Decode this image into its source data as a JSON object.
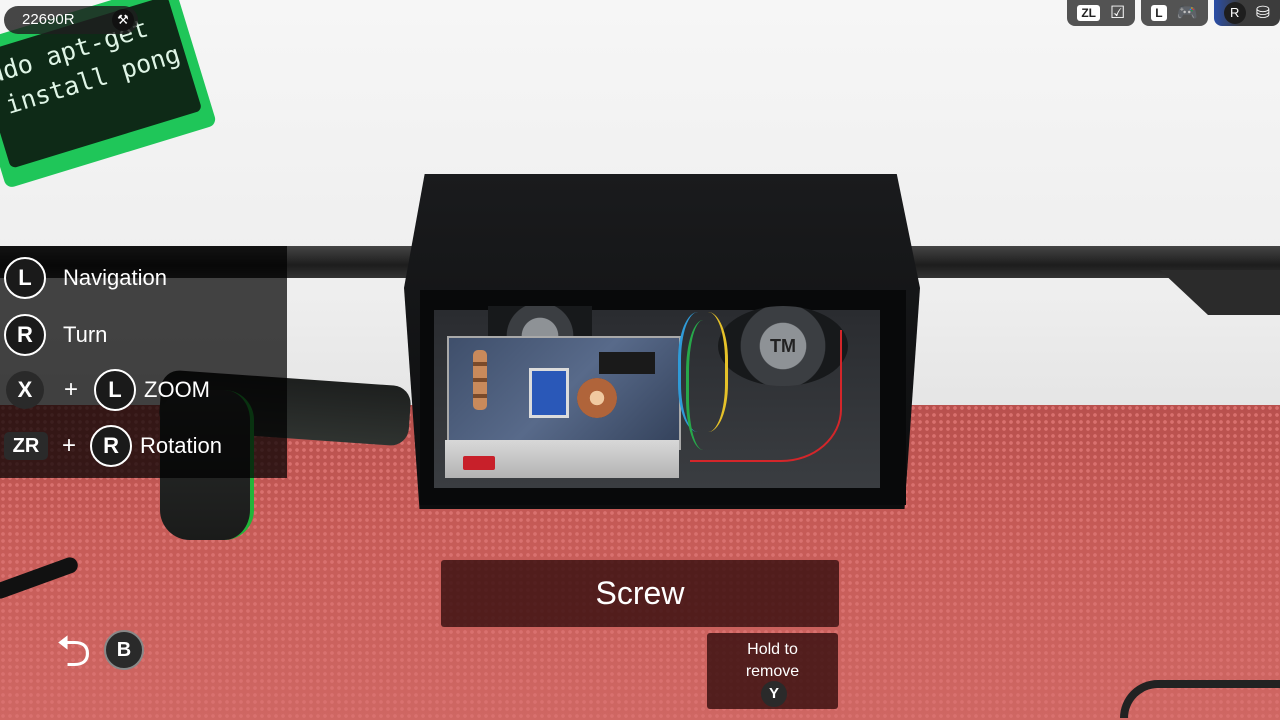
{
  "hud": {
    "currency": "22690R",
    "currency_icon": "wrench-icon"
  },
  "sticky_note": {
    "line1": "udo apt-get",
    "line2": "install pong"
  },
  "top_right": {
    "zl_label": "ZL",
    "l_label": "L",
    "r_label": "R"
  },
  "controls": {
    "navigation": {
      "button": "L",
      "label": "Navigation"
    },
    "turn": {
      "button": "R",
      "label": "Turn"
    },
    "zoom": {
      "button1": "X",
      "plus": "+",
      "button2": "L",
      "label": "ZOOM"
    },
    "rotation": {
      "button1": "ZR",
      "plus": "+",
      "button2": "R",
      "label": "Rotation"
    }
  },
  "back": {
    "button": "B"
  },
  "action": {
    "title": "Screw",
    "hold_text_1": "Hold to",
    "hold_text_2": "remove",
    "hold_button": "Y"
  },
  "device": {
    "speaker_label": "TM"
  },
  "colors": {
    "accent_green": "#1fc659",
    "panel_red": "#370f0f",
    "table": "#c65b57"
  }
}
